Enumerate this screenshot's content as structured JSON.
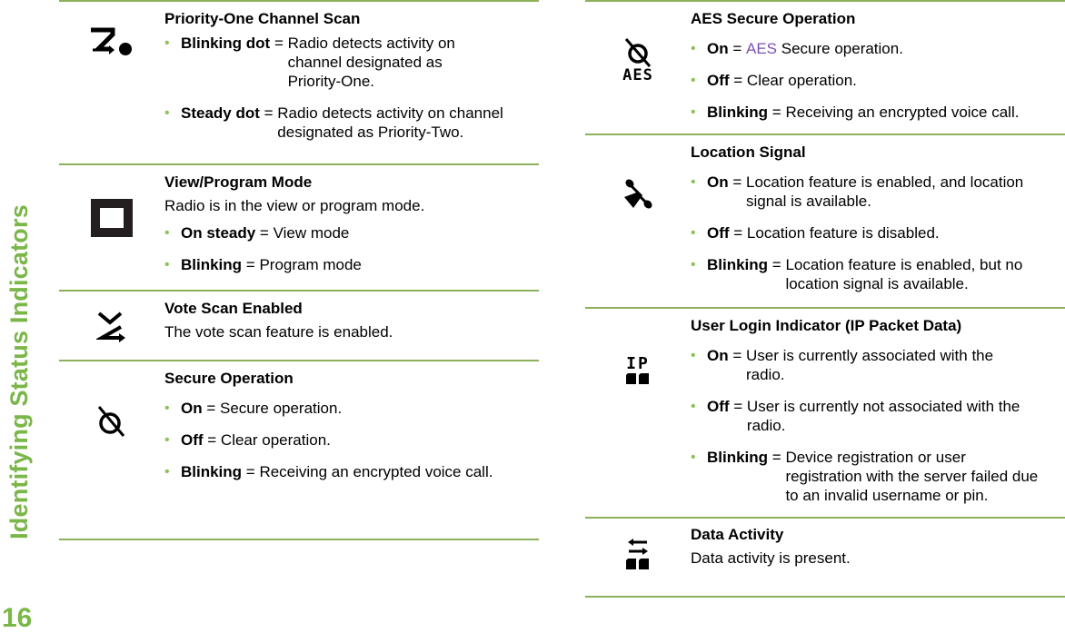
{
  "page": {
    "section_title": "Identifying Status Indicators",
    "page_number": "16",
    "accent_color": "#7ab648",
    "rule_color": "#8db05a"
  },
  "left_column": [
    {
      "icon": "priority-one-scan-icon",
      "title": "Priority-One Channel Scan",
      "items": [
        {
          "term": "Blinking dot",
          "definition": "Radio detects activity on channel designated as Priority-One."
        },
        {
          "term": "Steady dot",
          "definition": "Radio detects activity on channel designated as Priority-Two."
        }
      ]
    },
    {
      "icon": "view-program-mode-icon",
      "title": "View/Program Mode",
      "description": "Radio is in the view or program mode.",
      "items": [
        {
          "term": "On steady",
          "definition": "View mode"
        },
        {
          "term": "Blinking",
          "definition": "Program mode"
        }
      ]
    },
    {
      "icon": "vote-scan-icon",
      "title": "Vote Scan Enabled",
      "description": "The vote scan feature is enabled."
    },
    {
      "icon": "secure-operation-icon",
      "title": "Secure Operation",
      "items": [
        {
          "term": "On",
          "definition": "Secure operation."
        },
        {
          "term": "Off",
          "definition": "Clear operation."
        },
        {
          "term": "Blinking",
          "definition": "Receiving an encrypted voice call."
        }
      ]
    }
  ],
  "right_column": [
    {
      "icon": "aes-secure-operation-icon",
      "icon_label": "AES",
      "title": "AES Secure Operation",
      "items": [
        {
          "term": "On",
          "definition_highlight": "AES",
          "definition": " Secure operation.",
          "highlight_color": "#7b4fb5"
        },
        {
          "term": "Off",
          "definition": "Clear operation."
        },
        {
          "term": "Blinking",
          "definition": "Receiving an encrypted voice call."
        }
      ]
    },
    {
      "icon": "location-signal-icon",
      "title": "Location Signal",
      "items": [
        {
          "term": "On",
          "definition": "Location feature is enabled, and location signal is available."
        },
        {
          "term": "Off",
          "definition": "Location feature is disabled."
        },
        {
          "term": "Blinking",
          "definition": "Location feature is enabled, but no location signal is available."
        }
      ]
    },
    {
      "icon": "user-login-ip-icon",
      "icon_label": "IP",
      "title": "User Login Indicator (IP Packet Data)",
      "items": [
        {
          "term": "On",
          "definition": "User is currently associated with the radio."
        },
        {
          "term": "Off",
          "definition": "User is currently not associated with the radio."
        },
        {
          "term": "Blinking",
          "definition": "Device registration or user registration with the server failed due to an invalid username or pin."
        }
      ]
    },
    {
      "icon": "data-activity-icon",
      "title": "Data Activity",
      "description": "Data activity is present."
    }
  ],
  "bullet_glyph": "•",
  "equals": " = "
}
